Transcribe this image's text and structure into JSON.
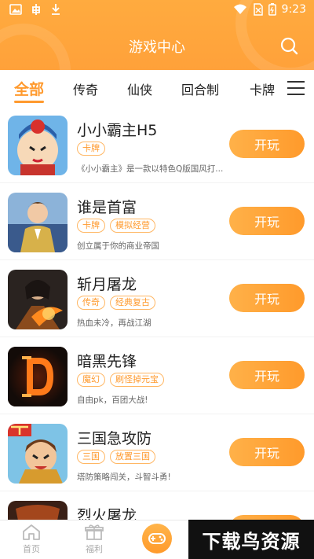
{
  "status_bar": {
    "time": "9:23",
    "icons": [
      "image-icon",
      "bug-icon",
      "download-icon",
      "wifi-icon",
      "no-sim-icon",
      "battery-icon"
    ]
  },
  "header": {
    "title": "游戏中心",
    "search_icon": "search-icon"
  },
  "tabs": [
    {
      "label": "全部",
      "active": true
    },
    {
      "label": "传奇",
      "active": false
    },
    {
      "label": "仙侠",
      "active": false
    },
    {
      "label": "回合制",
      "active": false
    },
    {
      "label": "卡牌",
      "active": false
    }
  ],
  "menu_icon": "menu-icon",
  "games": [
    {
      "name": "小小霸主H5",
      "tags": [
        "卡牌"
      ],
      "desc": "《小小霸主》是一款以特色Q版国风打...",
      "button": "开玩"
    },
    {
      "name": "谁是首富",
      "tags": [
        "卡牌",
        "模拟经营"
      ],
      "desc": "创立属于你的商业帝国",
      "button": "开玩"
    },
    {
      "name": "斩月屠龙",
      "tags": [
        "传奇",
        "经典复古"
      ],
      "desc": "热血未冷，再战江湖",
      "button": "开玩"
    },
    {
      "name": "暗黑先锋",
      "tags": [
        "魔幻",
        "刷怪掉元宝"
      ],
      "desc": "自由pk，百团大战!",
      "button": "开玩"
    },
    {
      "name": "三国急攻防",
      "tags": [
        "三国",
        "放置三国"
      ],
      "desc": "塔防策略闯关，斗智斗勇!",
      "button": "开玩"
    },
    {
      "name": "烈火屠龙",
      "tags": [],
      "desc": "",
      "button": "开玩"
    }
  ],
  "bottom_nav": [
    {
      "label": "首页",
      "icon": "home-icon"
    },
    {
      "label": "福利",
      "icon": "gift-icon"
    },
    {
      "label": "",
      "icon": "gamepad-icon"
    }
  ],
  "watermark": "下载鸟资源",
  "colors": {
    "accent": "#ff9a2e",
    "header": "#ffa83e"
  }
}
